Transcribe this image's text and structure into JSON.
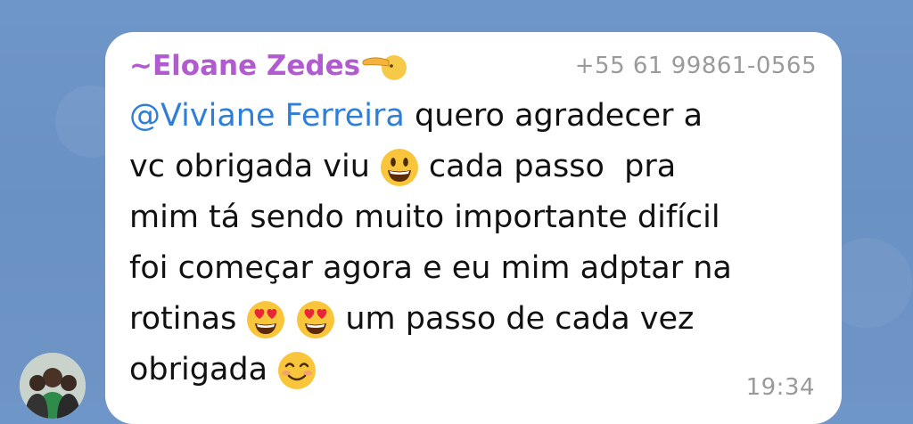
{
  "message": {
    "sender_name": "~Eloane Zedes",
    "sender_emoji": "backhand-index-pointing-left-emoji",
    "phone": "+55 61 99861-0565",
    "mention": "@Viviane Ferreira",
    "line1_rest": " quero agradecer a",
    "line2_a": "vc obrigada viu",
    "line2_b": "cada passo  pra",
    "line3": "mim tá sendo muito importante difícil",
    "line4": "foi começar agora e eu mim adptar na",
    "line5_a": "rotinas",
    "line5_b": "um passo de cada vez",
    "line6_a": "obrigada",
    "time": "19:34"
  },
  "icons": {
    "smiley": "grinning-face-emoji",
    "heart_eyes": "heart-eyes-emoji",
    "blush": "smiling-face-emoji"
  },
  "colors": {
    "sender": "#b25ad0",
    "mention": "#2f7fd8",
    "meta": "#9a9a9a",
    "bubble": "#ffffff",
    "background": "#6f96c8"
  }
}
